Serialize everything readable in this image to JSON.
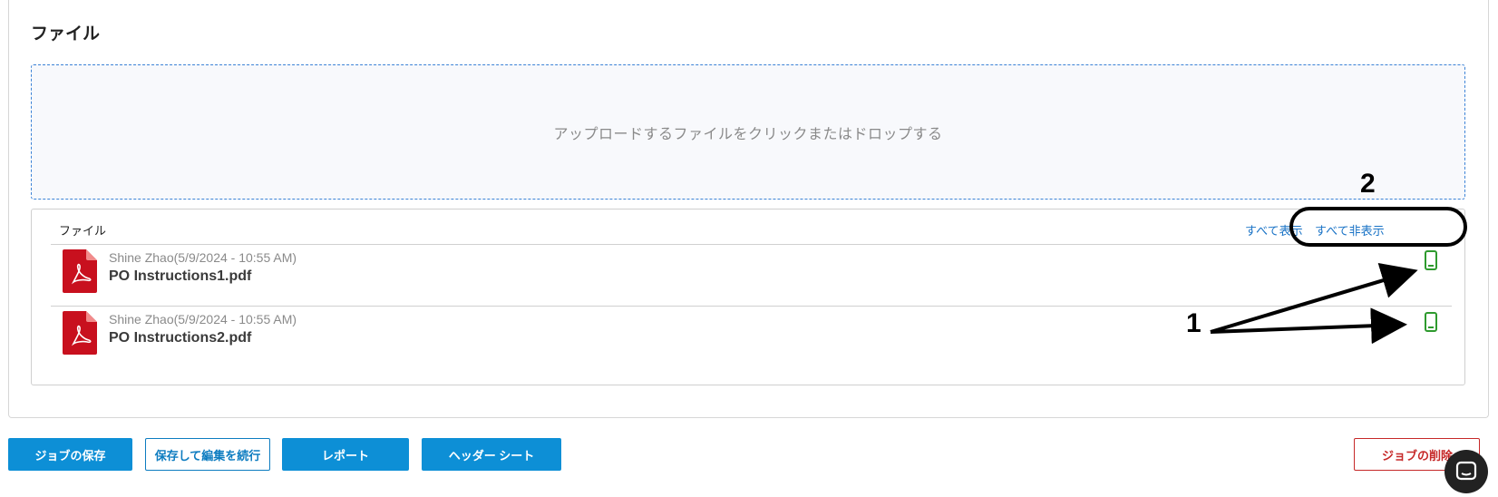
{
  "section": {
    "title": "ファイル"
  },
  "dropzone": {
    "text": "アップロードするファイルをクリックまたはドロップする"
  },
  "files_panel": {
    "header_label": "ファイル",
    "show_all": "すべて表示",
    "hide_all": "すべて非表示",
    "files": [
      {
        "meta": "Shine Zhao(5/9/2024 - 10:55 AM)",
        "name": "PO Instructions1.pdf",
        "icon": "pdf-icon",
        "visibility_icon": "phone-icon"
      },
      {
        "meta": "Shine Zhao(5/9/2024 - 10:55 AM)",
        "name": "PO Instructions2.pdf",
        "icon": "pdf-icon",
        "visibility_icon": "phone-icon"
      }
    ]
  },
  "annotations": {
    "label_1": "1",
    "label_2": "2"
  },
  "actions": {
    "save_job": "ジョブの保存",
    "save_and_continue": "保存して編集を続行",
    "report": "レポート",
    "header_sheet": "ヘッダー シート",
    "delete_job": "ジョブの削除"
  },
  "colors": {
    "primary": "#0d8fd6",
    "danger": "#c62828",
    "pdf_red": "#c8101e",
    "phone_green": "#2e9a2e",
    "link_blue": "#1a73c6"
  }
}
